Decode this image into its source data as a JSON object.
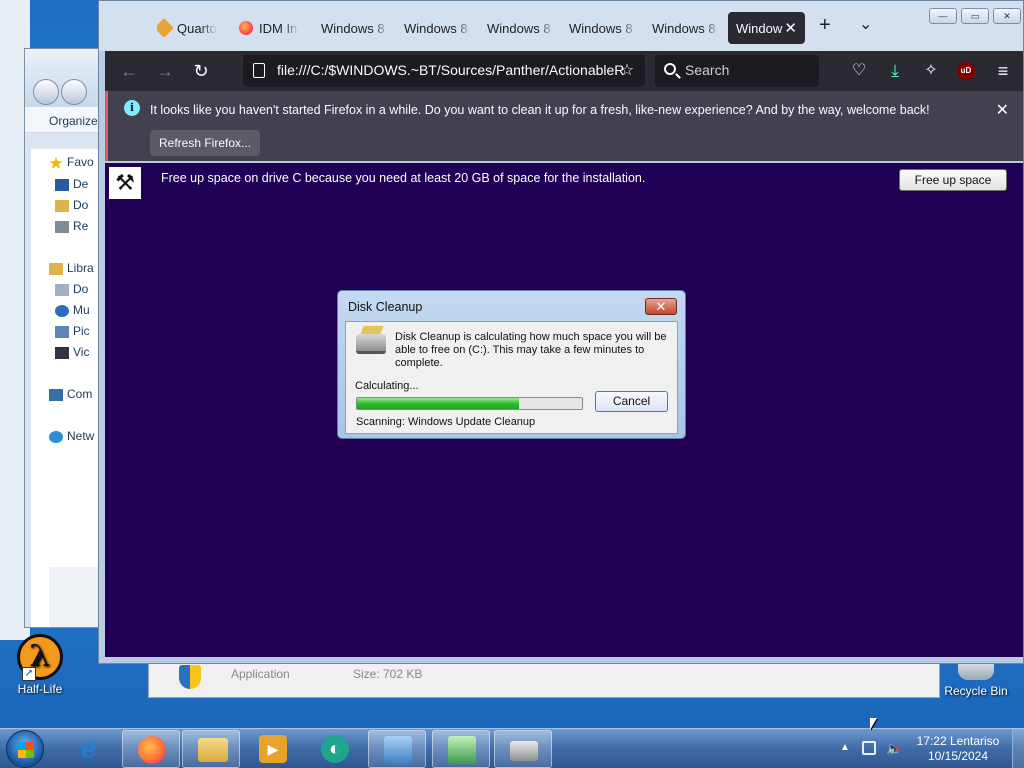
{
  "desktop": {
    "icons": [
      {
        "label": "Half-Life",
        "glyph": "λ",
        "icon": "half-life-icon"
      },
      {
        "label": "Recycle Bin",
        "icon": "recycle-bin-icon"
      }
    ],
    "explorer": {
      "organize": "Organize",
      "items": [
        {
          "label": "Favo",
          "icon": "star-icon",
          "color": "#f5b400"
        },
        {
          "label": "De",
          "icon": "desktop-icon",
          "color": "#2c5aa0"
        },
        {
          "label": "Do",
          "icon": "downloads-icon",
          "color": "#e0b24a"
        },
        {
          "label": "Re",
          "icon": "recent-places-icon",
          "color": "#7d8a99"
        },
        {
          "label": "Libra",
          "icon": "libraries-icon",
          "color": "#e0b24a"
        },
        {
          "label": "Do",
          "icon": "documents-icon",
          "color": "#9db0c6"
        },
        {
          "label": "Mu",
          "icon": "music-icon",
          "color": "#2c6fbf"
        },
        {
          "label": "Pic",
          "icon": "pictures-icon",
          "color": "#5a86b8"
        },
        {
          "label": "Vic",
          "icon": "videos-icon",
          "color": "#334"
        },
        {
          "label": "Com",
          "icon": "computer-icon",
          "color": "#3a6ea8"
        },
        {
          "label": "Netw",
          "icon": "network-icon",
          "color": "#2c8ed6"
        }
      ]
    },
    "setup_window": {
      "col1": "Application",
      "col2": "Size: 702 KB"
    }
  },
  "firefox": {
    "tabs": [
      {
        "label": "Quarto",
        "icon": "quarto-icon",
        "color": "#e8a23a"
      },
      {
        "label": "IDM Int",
        "icon": "firefox-icon",
        "color": "#ff7139"
      },
      {
        "label": "Windows 8",
        "icon": "",
        "color": ""
      },
      {
        "label": "Windows 8",
        "icon": "",
        "color": ""
      },
      {
        "label": "Windows 8",
        "icon": "",
        "color": ""
      },
      {
        "label": "Windows 8",
        "icon": "",
        "color": ""
      },
      {
        "label": "Windows 8",
        "icon": "",
        "color": ""
      },
      {
        "label": "Window",
        "icon": "",
        "color": "",
        "active": true
      }
    ],
    "new_tab": "+",
    "tab_list": "⌄",
    "url": "file:///C:/$WINDOWS.~BT/Sources/Panther/ActionableR",
    "search_placeholder": "Search",
    "ublock_label": "uD",
    "notice": {
      "text": "It looks like you haven't started Firefox in a while. Do you want to clean it up for a fresh, like-new experience? And by the way, welcome back!",
      "button": "Refresh Firefox..."
    },
    "content": {
      "message": "Free up space on drive C because you need at least 20 GB of space for the installation.",
      "button": "Free up space"
    }
  },
  "dialog": {
    "title": "Disk Cleanup",
    "message": "Disk Cleanup is calculating how much space you will be able to free on  (C:). This may take a few minutes to complete.",
    "status": "Calculating...",
    "progress_fraction": 0.72,
    "cancel": "Cancel",
    "scanning": "Scanning:   Windows Update Cleanup"
  },
  "taskbar": {
    "apps": [
      {
        "name": "internet-explorer",
        "glyph": "e",
        "color": "#1f7fd8",
        "open": false
      },
      {
        "name": "firefox",
        "glyph": "",
        "color": "#ff7139",
        "open": true
      },
      {
        "name": "windows-explorer",
        "glyph": "",
        "color": "#e8c25e",
        "open": true
      },
      {
        "name": "media-player",
        "glyph": "▶",
        "color": "#e8a42a",
        "open": false
      },
      {
        "name": "app-green",
        "glyph": "◐",
        "color": "#1fa58b",
        "open": false
      },
      {
        "name": "control-panel",
        "glyph": "",
        "color": "#4a8fd0",
        "open": true
      },
      {
        "name": "windows-setup",
        "glyph": "",
        "color": "#3c9a4b",
        "open": true
      },
      {
        "name": "disk-cleanup",
        "glyph": "",
        "color": "#aaaaaa",
        "open": true
      }
    ],
    "clock": {
      "time": "17:22 Lentariso",
      "date": "10/15/2024"
    }
  }
}
